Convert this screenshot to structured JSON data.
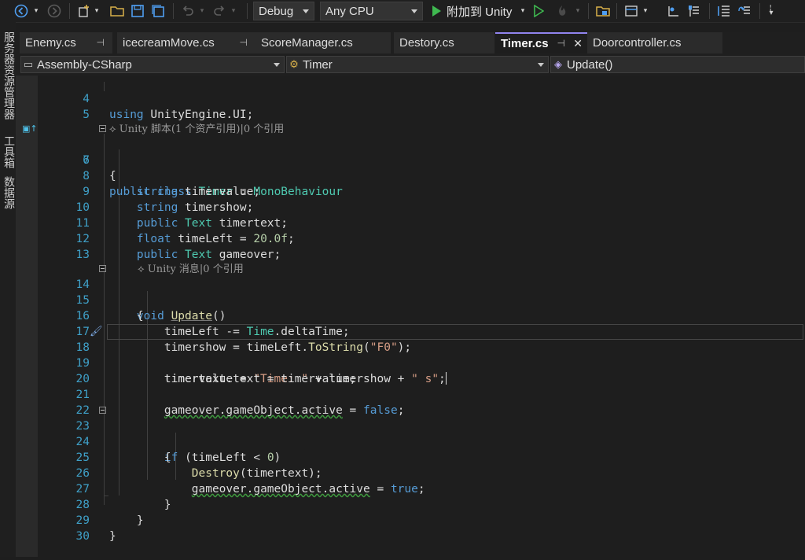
{
  "toolbar": {
    "config": "Debug",
    "platform": "Any CPU",
    "attach": "附加到 Unity"
  },
  "side_tabs": [
    "服务器资源管理器",
    "工具箱",
    "数据源"
  ],
  "tabs": [
    {
      "label": "Enemy.cs"
    },
    {
      "label": "icecreamMove.cs"
    },
    {
      "label": "ScoreManager.cs"
    },
    {
      "label": "Destory.cs"
    },
    {
      "label": "Timer.cs"
    },
    {
      "label": "Doorcontroller.cs"
    }
  ],
  "nav": {
    "project": "Assembly-CSharp",
    "class": "Timer",
    "member": "Update()"
  },
  "codelens": {
    "class": "Unity 脚本(1 个资产引用)|0 个引用",
    "method": "Unity 消息|0 个引用"
  },
  "lines": [
    {
      "n": "4",
      "text": "using UnityEngine.UI;"
    },
    {
      "n": "5",
      "text": ""
    },
    {
      "n": "6",
      "text": "public class Timer : MonoBehaviour"
    },
    {
      "n": "7",
      "text": "{"
    },
    {
      "n": "8",
      "text": "    string timervalue;"
    },
    {
      "n": "9",
      "text": "    string timershow;"
    },
    {
      "n": "10",
      "text": "    public Text timertext;"
    },
    {
      "n": "11",
      "text": "    float timeLeft = 20.0f;"
    },
    {
      "n": "12",
      "text": "    public Text gameover;"
    },
    {
      "n": "13",
      "text": ""
    },
    {
      "n": "14",
      "text": "    void Update()"
    },
    {
      "n": "15",
      "text": "    {"
    },
    {
      "n": "16",
      "text": "        timeLeft -= Time.deltaTime;"
    },
    {
      "n": "17",
      "text": "        timershow = timeLeft.ToString(\"F0\");"
    },
    {
      "n": "18",
      "text": "        timervalue = \"Time: \" + timershow + \" s\";"
    },
    {
      "n": "19",
      "text": "        timertext.text = timervalue;"
    },
    {
      "n": "20",
      "text": ""
    },
    {
      "n": "21",
      "text": "        gameover.gameObject.active = false;"
    },
    {
      "n": "22",
      "text": ""
    },
    {
      "n": "23",
      "text": "        if (timeLeft < 0)"
    },
    {
      "n": "24",
      "text": "        {"
    },
    {
      "n": "25",
      "text": "            Destroy(timertext);"
    },
    {
      "n": "26",
      "text": "            gameover.gameObject.active = true;"
    },
    {
      "n": "27",
      "text": "        }"
    },
    {
      "n": "28",
      "text": "    }"
    },
    {
      "n": "29",
      "text": "}"
    },
    {
      "n": "30",
      "text": ""
    }
  ]
}
